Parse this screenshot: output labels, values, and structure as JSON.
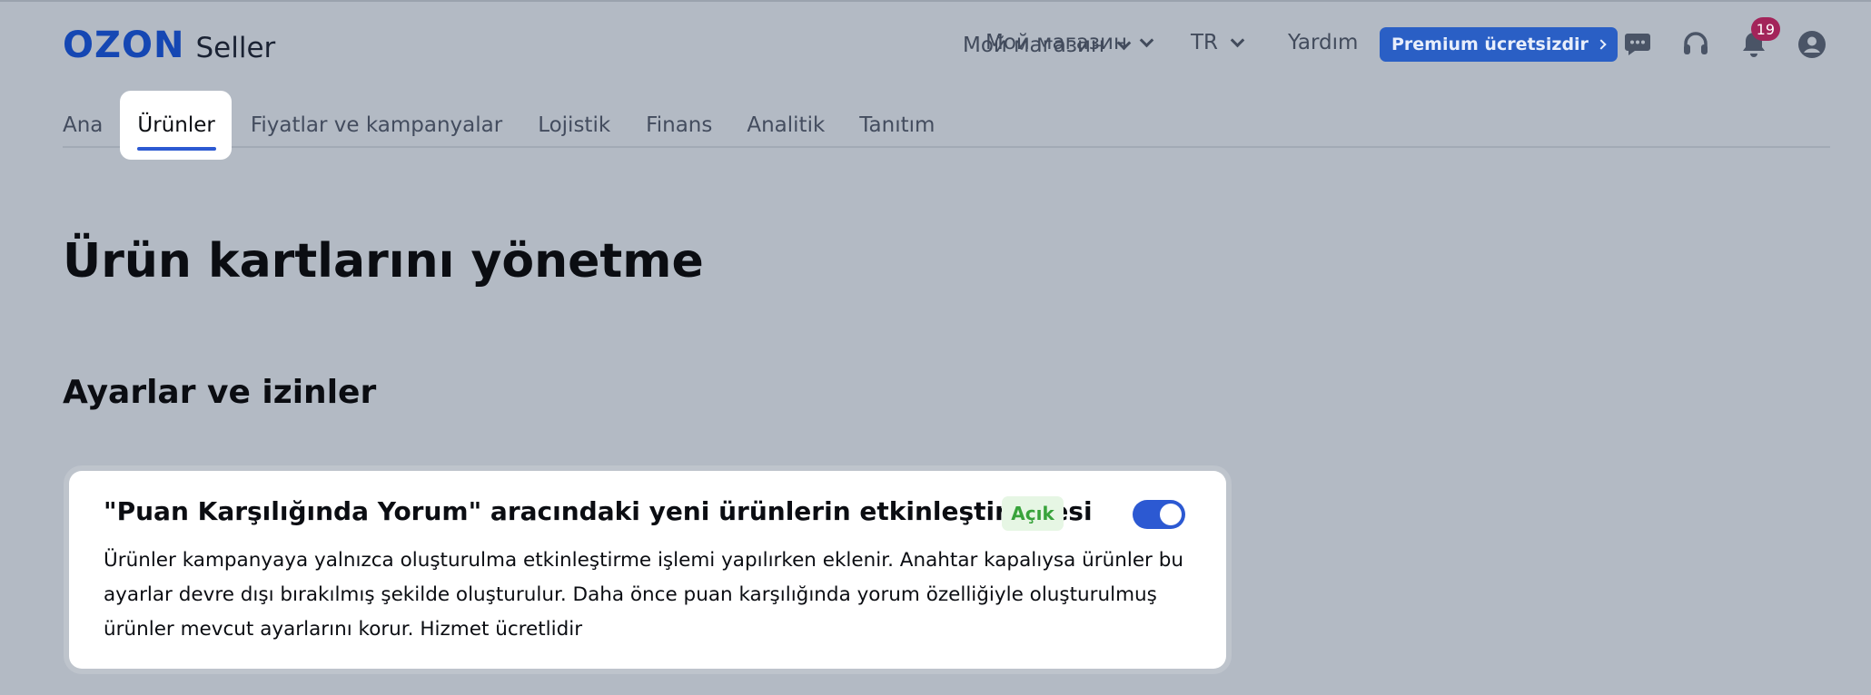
{
  "header": {
    "logo_mark": "OZON",
    "logo_product": "Seller",
    "store_menu": "Мой магазин",
    "language": "TR",
    "help": "Yardım",
    "premium": "Premium ücretsizdir",
    "notifications_count": "19",
    "icons": [
      "chat-icon",
      "headset-icon",
      "bell-icon",
      "user-icon"
    ]
  },
  "tabs": [
    {
      "label": "Ana",
      "active": false
    },
    {
      "label": "Ürünler",
      "active": true
    },
    {
      "label": "Fiyatlar ve kampanyalar",
      "active": false
    },
    {
      "label": "Lojistik",
      "active": false
    },
    {
      "label": "Finans",
      "active": false
    },
    {
      "label": "Analitik",
      "active": false
    },
    {
      "label": "Tanıtım",
      "active": false
    }
  ],
  "page_title": "Ürün kartlarını yönetme",
  "section_title": "Ayarlar ve izinler",
  "setting": {
    "title": "\"Puan Karşılığında Yorum\" aracındaki yeni ürünlerin etkinleştirilmesi",
    "status": "Açık",
    "enabled": true,
    "description": "Ürünler kampanyaya yalnızca oluşturulma etkinleştirme işlemi yapılırken eklenir. Anahtar kapalıysa ürünler bu ayarlar devre dışı bırakılmış şekilde oluşturulur. Daha önce puan karşılığında yorum özelliğiyle oluşturulmuş ürünler mevcut ayarlarını korur. Hizmet ücretlidir"
  },
  "colors": {
    "background": "#b3bac4",
    "brand": "#1547b3",
    "accent": "#2c59d2",
    "status_on": "#38a33b",
    "badge": "#a3245a"
  }
}
